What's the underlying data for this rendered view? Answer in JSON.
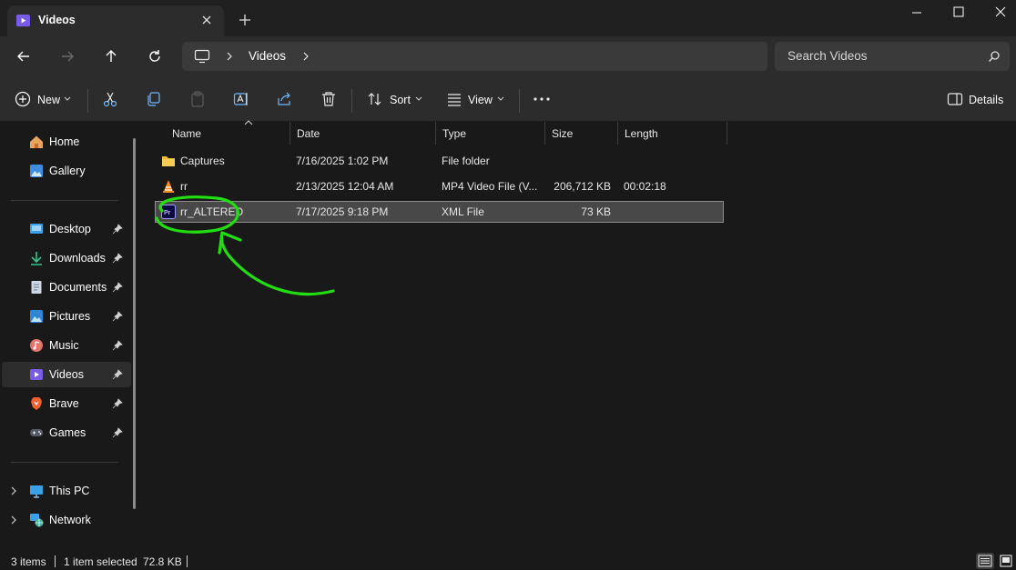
{
  "window": {
    "tab_title": "Videos",
    "tab_icon": "videos-folder-icon",
    "controls": [
      "minimize-icon",
      "maximize-icon",
      "close-icon"
    ]
  },
  "address": {
    "segments": [
      "Videos"
    ],
    "search_placeholder": "Search Videos"
  },
  "toolbar": {
    "new_label": "New",
    "sort_label": "Sort",
    "view_label": "View",
    "details_label": "Details",
    "icons": [
      "cut-icon",
      "copy-icon",
      "paste-icon",
      "rename-icon",
      "share-icon",
      "delete-icon",
      "more-icon"
    ]
  },
  "sidebar": {
    "top": [
      {
        "label": "Home",
        "icon": "home-icon"
      },
      {
        "label": "Gallery",
        "icon": "gallery-icon"
      }
    ],
    "quick_access": [
      {
        "label": "Desktop",
        "icon": "desktop-icon"
      },
      {
        "label": "Downloads",
        "icon": "downloads-icon"
      },
      {
        "label": "Documents",
        "icon": "documents-icon"
      },
      {
        "label": "Pictures",
        "icon": "pictures-icon"
      },
      {
        "label": "Music",
        "icon": "music-icon"
      },
      {
        "label": "Videos",
        "icon": "videos-icon"
      },
      {
        "label": "Brave",
        "icon": "brave-icon"
      },
      {
        "label": "Games",
        "icon": "games-icon"
      }
    ],
    "bottom": [
      {
        "label": "This PC",
        "icon": "this-pc-icon"
      },
      {
        "label": "Network",
        "icon": "network-icon"
      }
    ],
    "selected": "Videos"
  },
  "columns": {
    "name": "Name",
    "date": "Date",
    "type": "Type",
    "size": "Size",
    "length": "Length"
  },
  "files": [
    {
      "name": "Captures",
      "date": "7/16/2025 1:02 PM",
      "type": "File folder",
      "size": "",
      "length": "",
      "icon": "folder-icon"
    },
    {
      "name": "rr",
      "date": "2/13/2025 12:04 AM",
      "type": "MP4 Video File (V...",
      "size": "206,712 KB",
      "length": "00:02:18",
      "icon": "vlc-icon"
    },
    {
      "name": "rr_ALTERED",
      "date": "7/17/2025 9:18 PM",
      "type": "XML File",
      "size": "73 KB",
      "length": "",
      "icon": "premiere-pro-icon",
      "selected": true
    }
  ],
  "status": {
    "items": "3 items",
    "selection": "1 item selected",
    "selection_size": "72.8 KB"
  },
  "colors": {
    "accent": "#7a6ff0",
    "annotation": "#22dd11"
  }
}
